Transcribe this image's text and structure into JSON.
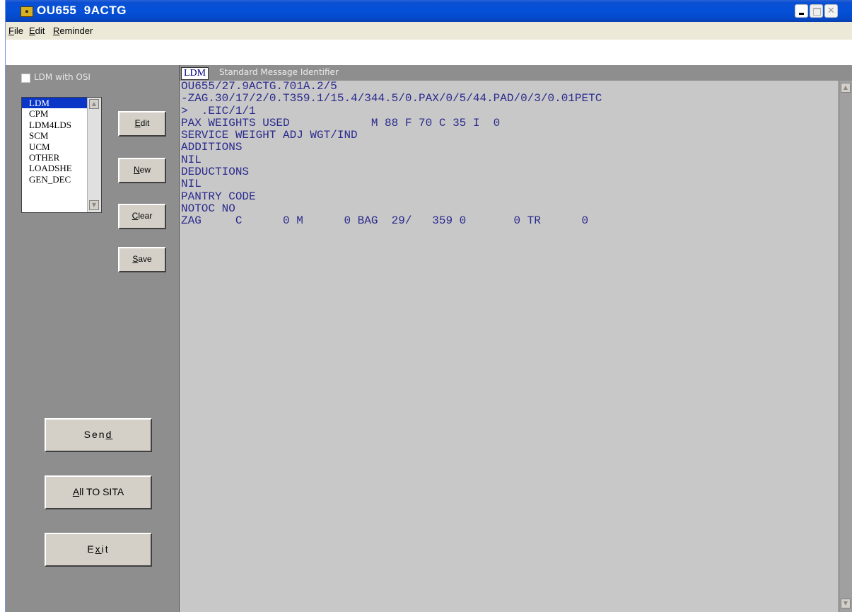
{
  "window": {
    "title": "OU655  9ACTG",
    "app_icon": "app-logo-icon",
    "controls": [
      "minimize-icon",
      "maximize-icon",
      "close-icon"
    ]
  },
  "menubar": {
    "items": [
      {
        "label": "File",
        "accel": "F",
        "rest": "ile"
      },
      {
        "label": "Edit",
        "accel": "E",
        "rest": "dit"
      },
      {
        "label": "Reminder",
        "accel": "R",
        "rest": "eminder"
      }
    ]
  },
  "left_panel": {
    "checkbox": {
      "label": "LDM with OSI",
      "checked": false
    },
    "message_types": [
      "LDM",
      "CPM",
      "LDM4LDS",
      "SCM",
      "UCM",
      "OTHER",
      "LOADSHE",
      "GEN_DEC"
    ],
    "selected_type": "LDM",
    "side_buttons": [
      {
        "accel": "E",
        "rest": "dit"
      },
      {
        "accel": "N",
        "rest": "ew"
      },
      {
        "accel": "C",
        "rest": "lear"
      },
      {
        "accel": "S",
        "rest": "ave"
      }
    ],
    "big_buttons": [
      {
        "pre": "Sen",
        "accel": "d",
        "post": ""
      },
      {
        "pre": "",
        "accel": "A",
        "post": "ll TO SITA"
      },
      {
        "pre": "E",
        "accel": "x",
        "post": "it"
      }
    ]
  },
  "message": {
    "identifier": "LDM",
    "identifier_label": "Standard Message Identifier",
    "lines": [
      "OU655/27.9ACTG.701A.2/5",
      "-ZAG.30/17/2/0.T359.1/15.4/344.5/0.PAX/0/5/44.PAD/0/3/0.01PETC",
      ">  .EIC/1/1",
      "PAX WEIGHTS USED            M 88 F 70 C 35 I  0",
      "SERVICE WEIGHT ADJ WGT/IND",
      "ADDITIONS",
      "NIL",
      "DEDUCTIONS",
      "NIL",
      "PANTRY CODE",
      "NOTOC NO",
      "ZAG     C      0 M      0 BAG  29/   359 0       0 TR      0"
    ]
  }
}
